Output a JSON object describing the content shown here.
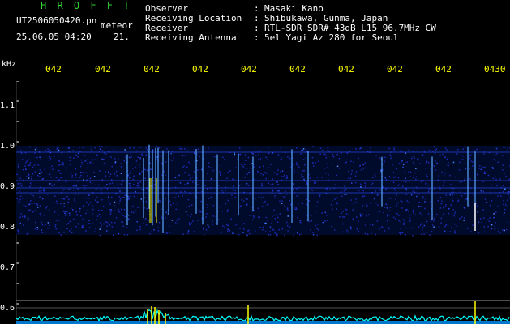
{
  "header": {
    "title": "H R O F F T",
    "filename": "UT2506050420.pn",
    "mode": "meteor",
    "datetime": "25.06.05 04:20",
    "number": "21.",
    "info": [
      {
        "label": "Observer",
        "value": "Masaki Kano"
      },
      {
        "label": "Receiving Location",
        "value": "Shibukawa, Gunma, Japan"
      },
      {
        "label": "Receiver",
        "value": "RTL-SDR SDR# 43dB L15 96.7MHz CW"
      },
      {
        "label": "Receiving Antenna",
        "value": "5el Yagi Az 280 for Seoul"
      }
    ],
    "separator": ":"
  },
  "time_axis": {
    "labels": [
      "042",
      "042",
      "042",
      "042",
      "042",
      "042",
      "042",
      "042",
      "042",
      "0430"
    ]
  },
  "freq_axis": {
    "unit": "kHz",
    "ticks": [
      "1.1",
      "1.0",
      "0.9",
      "0.8",
      "0.7",
      "0.6"
    ]
  },
  "colors": {
    "background": "#000000",
    "time_label": "#ffff00",
    "title": "#33dd33",
    "noise_band": "#1b2ab0",
    "signal_peak": "#ffff00",
    "power_trace": "#00ffff"
  }
}
